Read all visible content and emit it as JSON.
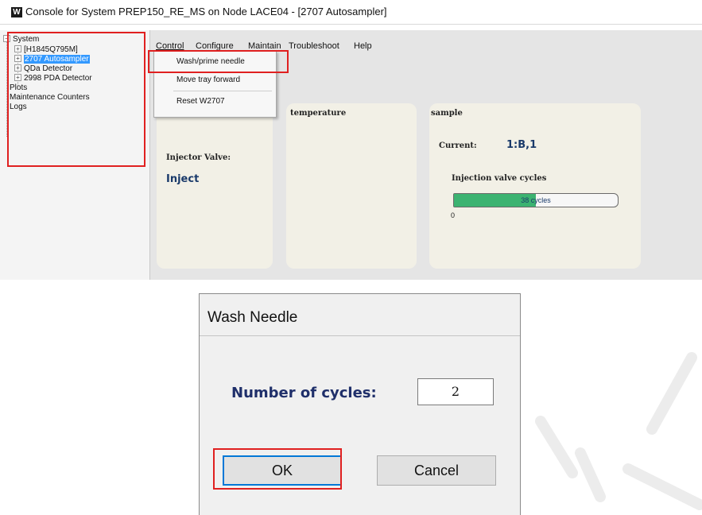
{
  "console": {
    "title": "Console for System PREP150_RE_MS on Node LACE04 - [2707 Autosampler]",
    "logo_letter": "W",
    "tree": {
      "root": "System",
      "children": [
        "[H1845Q795M]",
        "2707 Autosampler",
        "QDa Detector",
        "2998 PDA Detector"
      ],
      "top_items": [
        "Plots",
        "Maintenance Counters",
        "Logs"
      ]
    },
    "menu": [
      "Control",
      "Configure",
      "Maintain",
      "Troubleshoot",
      "Help"
    ],
    "control_menu": [
      "Wash/prime needle",
      "Move tray forward",
      "Reset W2707"
    ],
    "panels": {
      "temperature_title": "temperature",
      "sample_title": "sample",
      "injector_label": "Injector Valve:",
      "injector_value": "Inject",
      "current_label": "Current:",
      "current_value": "1:B,1",
      "cycles_label": "Injection valve cycles",
      "cycles_text": "38 cycles",
      "cycles_min": "0",
      "cycles_fraction": 0.5
    }
  },
  "dialog": {
    "title": "Wash Needle",
    "cycles_label": "Number of cycles:",
    "cycles_value": "2",
    "ok_label": "OK",
    "cancel_label": "Cancel"
  },
  "colors": {
    "highlight_box": "#e02020",
    "tree_selection": "#3399ff",
    "progress_fill": "#3cb371",
    "panel_bg": "#f2f0e6",
    "dialog_accent": "#0078d7"
  }
}
